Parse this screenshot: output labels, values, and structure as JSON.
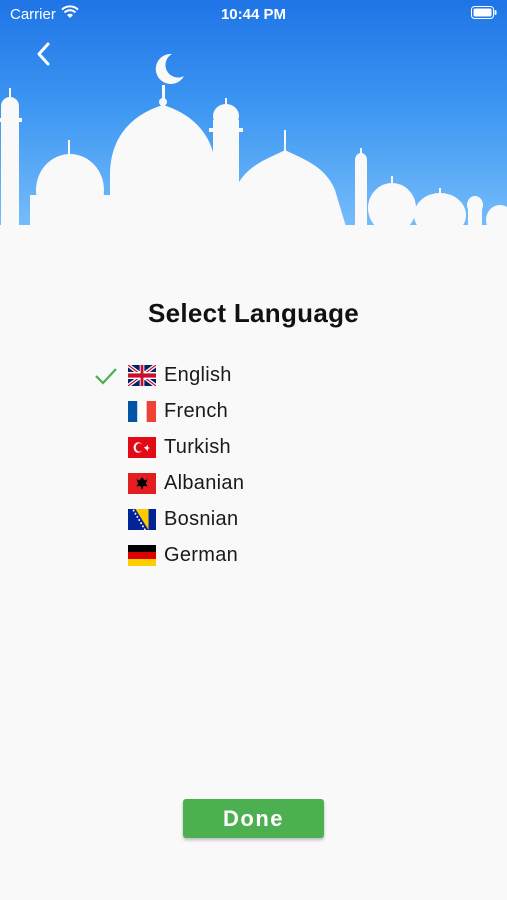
{
  "status_bar": {
    "carrier": "Carrier",
    "time": "10:44 PM"
  },
  "nav": {
    "back_icon": "chevron-left-icon"
  },
  "title": "Select Language",
  "languages": [
    {
      "label": "English",
      "flag": "uk-flag-icon",
      "selected": true
    },
    {
      "label": "French",
      "flag": "france-flag-icon",
      "selected": false
    },
    {
      "label": "Turkish",
      "flag": "turkey-flag-icon",
      "selected": false
    },
    {
      "label": "Albanian",
      "flag": "albania-flag-icon",
      "selected": false
    },
    {
      "label": "Bosnian",
      "flag": "bosnia-flag-icon",
      "selected": false
    },
    {
      "label": "German",
      "flag": "germany-flag-icon",
      "selected": false
    }
  ],
  "done_label": "Done",
  "colors": {
    "header_top": "#1f74e6",
    "header_bottom": "#7cc0fb",
    "accent": "#4caf50",
    "check": "#4caf50",
    "background": "#f9f9f9"
  }
}
